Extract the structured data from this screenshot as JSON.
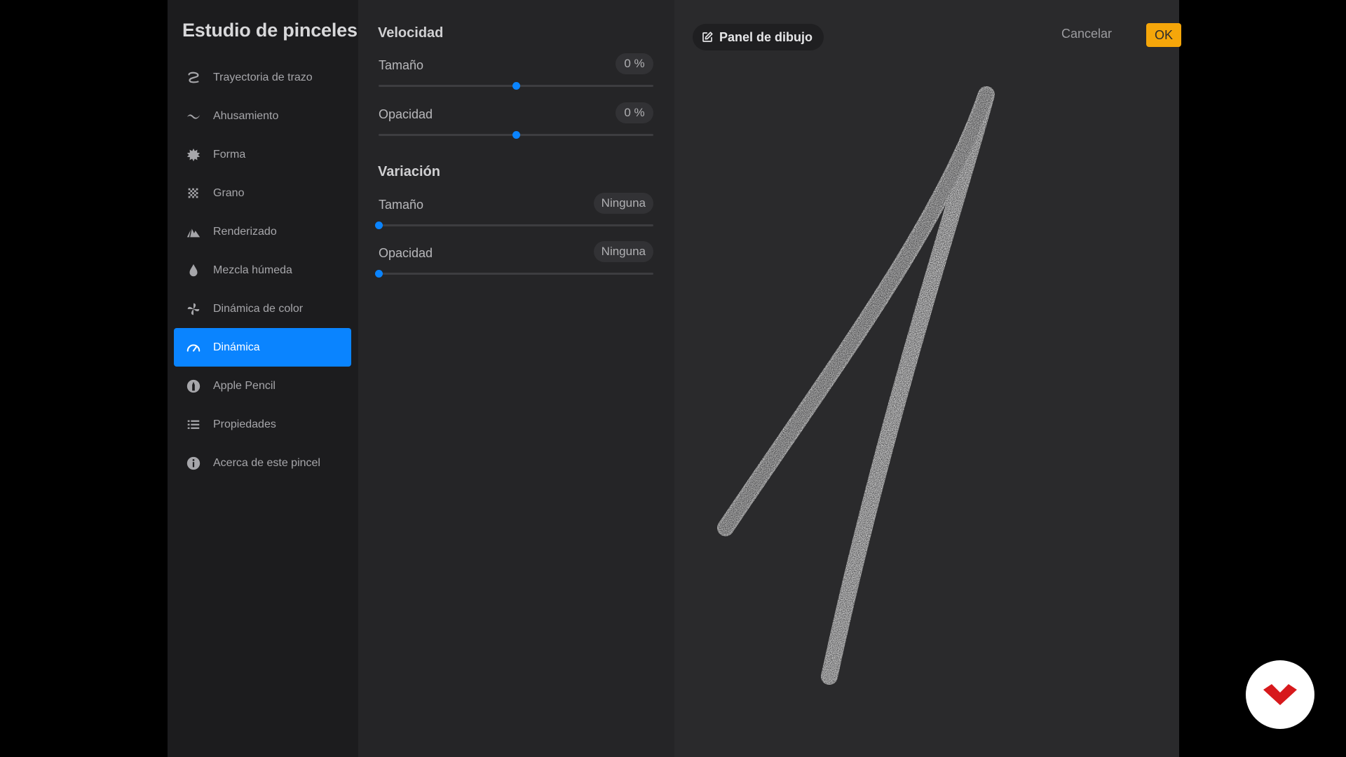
{
  "sidebar": {
    "title": "Estudio de pinceles",
    "items": [
      {
        "label": "Trayectoria de trazo",
        "icon": "stroke-path-icon",
        "active": false
      },
      {
        "label": "Ahusamiento",
        "icon": "taper-icon",
        "active": false
      },
      {
        "label": "Forma",
        "icon": "shape-icon",
        "active": false
      },
      {
        "label": "Grano",
        "icon": "grain-icon",
        "active": false
      },
      {
        "label": "Renderizado",
        "icon": "rendering-icon",
        "active": false
      },
      {
        "label": "Mezcla húmeda",
        "icon": "wet-mix-icon",
        "active": false
      },
      {
        "label": "Dinámica de color",
        "icon": "color-dynamics-icon",
        "active": false
      },
      {
        "label": "Dinámica",
        "icon": "dynamics-icon",
        "active": true
      },
      {
        "label": "Apple Pencil",
        "icon": "apple-pencil-icon",
        "active": false
      },
      {
        "label": "Propiedades",
        "icon": "properties-icon",
        "active": false
      },
      {
        "label": "Acerca de este pincel",
        "icon": "info-icon",
        "active": false
      }
    ]
  },
  "settings": {
    "velocidad": {
      "title": "Velocidad",
      "size": {
        "label": "Tamaño",
        "value": "0 %",
        "level": 0.5
      },
      "opacity": {
        "label": "Opacidad",
        "value": "0 %",
        "level": 0.5
      }
    },
    "variacion": {
      "title": "Variación",
      "size": {
        "label": "Tamaño",
        "value": "Ninguna",
        "level": 0.0
      },
      "opacity": {
        "label": "Opacidad",
        "value": "Ninguna",
        "level": 0.0
      }
    }
  },
  "pad": {
    "badge_label": "Panel de dibujo",
    "badge_icon": "edit-icon",
    "cancel_label": "Cancelar",
    "ok_label": "OK"
  },
  "colors": {
    "accent": "#0a84ff",
    "ok": "#f5a60a",
    "logo": "#d7191c"
  }
}
